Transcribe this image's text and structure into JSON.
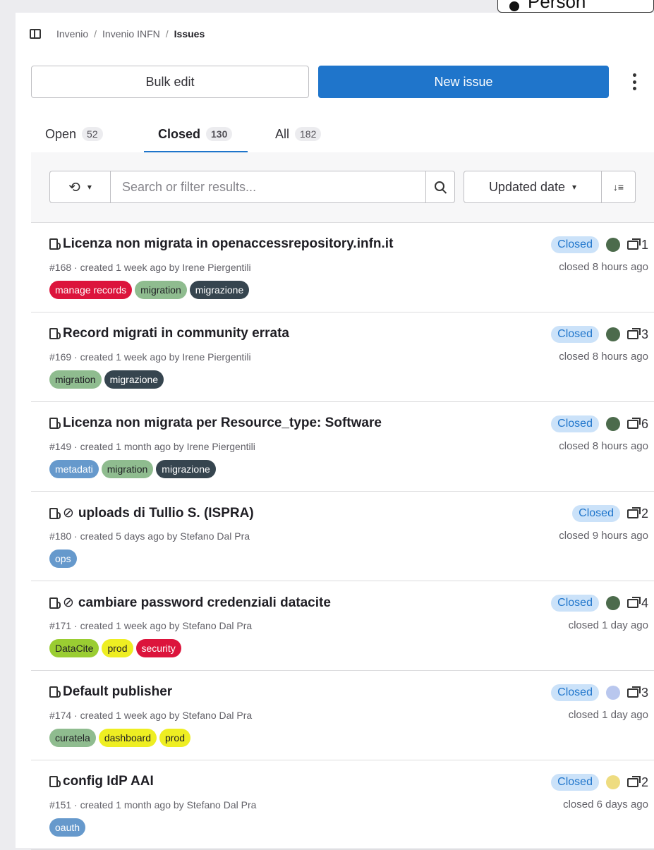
{
  "overlay": {
    "person_label": "Person"
  },
  "breadcrumb": {
    "items": [
      "Invenio",
      "Invenio INFN"
    ],
    "current": "Issues"
  },
  "actions": {
    "bulk_edit": "Bulk edit",
    "new_issue": "New issue"
  },
  "tabs": [
    {
      "label": "Open",
      "count": "52"
    },
    {
      "label": "Closed",
      "count": "130",
      "active": true
    },
    {
      "label": "All",
      "count": "182"
    }
  ],
  "filter": {
    "placeholder": "Search or filter results...",
    "sort_label": "Updated date"
  },
  "colors": {
    "primary": "#1f75cb",
    "closed_badge_bg": "#cbe2f9",
    "label_red": "#dd2b0e",
    "label_green": "#8fbc8f",
    "label_dark": "#36454f",
    "label_blue": "#6699cc",
    "label_lime": "#9acd32",
    "label_yellow": "#dddd00"
  },
  "issues": [
    {
      "title": "Licenza non migrata in openaccessrepository.infn.it",
      "meta": "#168 · created 1 week ago by Irene Piergentili",
      "labels": [
        {
          "text": "manage records",
          "color": "#dc143c",
          "light": false
        },
        {
          "text": "migration",
          "color": "#8fbc8f",
          "light": true
        },
        {
          "text": "migrazione",
          "color": "#36454f",
          "light": false
        }
      ],
      "status": "Closed",
      "avatar_color": "#4c6b4c",
      "comments": "1",
      "closed": "closed 8 hours ago",
      "confidential": false
    },
    {
      "title": "Record migrati in community errata",
      "meta": "#169 · created 1 week ago by Irene Piergentili",
      "labels": [
        {
          "text": "migration",
          "color": "#8fbc8f",
          "light": true
        },
        {
          "text": "migrazione",
          "color": "#36454f",
          "light": false
        }
      ],
      "status": "Closed",
      "avatar_color": "#4c6b4c",
      "comments": "3",
      "closed": "closed 8 hours ago",
      "confidential": false
    },
    {
      "title": "Licenza non migrata per Resource_type: Software",
      "meta": "#149 · created 1 month ago by Irene Piergentili",
      "labels": [
        {
          "text": "metadati",
          "color": "#6699cc",
          "light": false
        },
        {
          "text": "migration",
          "color": "#8fbc8f",
          "light": true
        },
        {
          "text": "migrazione",
          "color": "#36454f",
          "light": false
        }
      ],
      "status": "Closed",
      "avatar_color": "#4c6b4c",
      "comments": "6",
      "closed": "closed 8 hours ago",
      "confidential": false
    },
    {
      "title": "uploads di Tullio S. (ISPRA)",
      "meta": "#180 · created 5 days ago by Stefano Dal Pra",
      "labels": [
        {
          "text": "ops",
          "color": "#6699cc",
          "light": false
        }
      ],
      "status": "Closed",
      "avatar_color": "",
      "comments": "2",
      "closed": "closed 9 hours ago",
      "confidential": true
    },
    {
      "title": "cambiare password credenziali datacite",
      "meta": "#171 · created 1 week ago by Stefano Dal Pra",
      "labels": [
        {
          "text": "DataCite",
          "color": "#9acd32",
          "light": true
        },
        {
          "text": "prod",
          "color": "#eeee22",
          "light": true
        },
        {
          "text": "security",
          "color": "#dc143c",
          "light": false
        }
      ],
      "status": "Closed",
      "avatar_color": "#4c6b4c",
      "comments": "4",
      "closed": "closed 1 day ago",
      "confidential": true
    },
    {
      "title": "Default publisher",
      "meta": "#174 · created 1 week ago by Stefano Dal Pra",
      "labels": [
        {
          "text": "curatela",
          "color": "#8fbc8f",
          "light": true
        },
        {
          "text": "dashboard",
          "color": "#eeee22",
          "light": true
        },
        {
          "text": "prod",
          "color": "#eeee22",
          "light": true
        }
      ],
      "status": "Closed",
      "avatar_color": "#b9c7ee",
      "comments": "3",
      "closed": "closed 1 day ago",
      "confidential": false
    },
    {
      "title": "config IdP AAI",
      "meta": "#151 · created 1 month ago by Stefano Dal Pra",
      "labels": [
        {
          "text": "oauth",
          "color": "#6699cc",
          "light": false
        }
      ],
      "status": "Closed",
      "avatar_color": "#eedc80",
      "comments": "2",
      "closed": "closed 6 days ago",
      "confidential": false
    }
  ]
}
